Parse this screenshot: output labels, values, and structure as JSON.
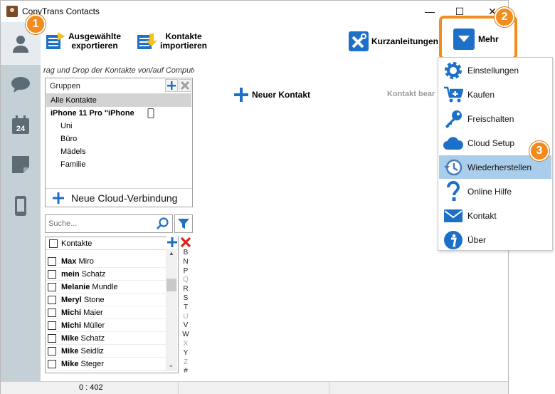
{
  "window": {
    "title": "CopyTrans Contacts",
    "minimize": "—",
    "maximize": "☐",
    "close": "✕"
  },
  "toolbar": {
    "export_label": "Ausgewählte exportieren",
    "import_label": "Kontakte importieren",
    "guides_label": "Kurzanleitungen",
    "more_label": "Mehr"
  },
  "hint": "rag und Drop der Kontakte von/auf Computer",
  "groups": {
    "header": "Gruppen",
    "items": [
      {
        "label": "Alle Kontakte",
        "indent": false,
        "bold": false,
        "selected": true
      },
      {
        "label": "iPhone 11 Pro \"iPhone ",
        "indent": false,
        "bold": true,
        "selected": false
      },
      {
        "label": "Uni",
        "indent": true,
        "bold": false,
        "selected": false
      },
      {
        "label": "Büro",
        "indent": true,
        "bold": false,
        "selected": false
      },
      {
        "label": "Mädels",
        "indent": true,
        "bold": false,
        "selected": false
      },
      {
        "label": "Familie",
        "indent": true,
        "bold": false,
        "selected": false
      }
    ],
    "cloud_label": "Neue Cloud-Verbindung"
  },
  "search": {
    "placeholder": "Suche..."
  },
  "contacts": {
    "header": "Kontakte",
    "rows": [
      {
        "first": "Max",
        "last": "Miro"
      },
      {
        "first": "mein",
        "last": "Schatz"
      },
      {
        "first": "Melanie",
        "last": "Mundle"
      },
      {
        "first": "Meryl",
        "last": "Stone"
      },
      {
        "first": "Michi",
        "last": "Maier"
      },
      {
        "first": "Michi",
        "last": "Müller"
      },
      {
        "first": "Mike",
        "last": "Schatz"
      },
      {
        "first": "Mike",
        "last": "Seidliz"
      },
      {
        "first": "Mike",
        "last": "Steger"
      }
    ]
  },
  "alphabet": [
    {
      "l": "B",
      "dim": false
    },
    {
      "l": "N",
      "dim": false
    },
    {
      "l": "P",
      "dim": false
    },
    {
      "l": "Q",
      "dim": true
    },
    {
      "l": "R",
      "dim": false
    },
    {
      "l": "S",
      "dim": false
    },
    {
      "l": "T",
      "dim": false
    },
    {
      "l": "U",
      "dim": true
    },
    {
      "l": "V",
      "dim": false
    },
    {
      "l": "W",
      "dim": false
    },
    {
      "l": "X",
      "dim": true
    },
    {
      "l": "Y",
      "dim": false
    },
    {
      "l": "Z",
      "dim": true
    },
    {
      "l": "#",
      "dim": false
    }
  ],
  "main": {
    "new_contact": "Neuer Kontakt",
    "edit_contact": "Kontakt bear"
  },
  "status": {
    "count": "0 : 402"
  },
  "badges": [
    "1",
    "2",
    "3"
  ],
  "menu": {
    "items": [
      {
        "label": "Einstellungen",
        "icon": "gear-icon"
      },
      {
        "label": "Kaufen",
        "icon": "cart-icon"
      },
      {
        "label": "Freischalten",
        "icon": "key-icon"
      },
      {
        "label": "Cloud Setup",
        "icon": "cloud-icon"
      },
      {
        "label": "Wiederherstellen",
        "icon": "history-icon"
      },
      {
        "label": "Online Hilfe",
        "icon": "question-icon"
      },
      {
        "label": "Kontakt",
        "icon": "mail-icon"
      },
      {
        "label": "Über",
        "icon": "info-icon"
      }
    ],
    "highlighted_index": 4
  },
  "colors": {
    "accent_orange": "#f28c1c",
    "accent_blue": "#1c70c7",
    "menu_highlight": "#a9cdea",
    "sidebar": "#c4cfd6"
  }
}
